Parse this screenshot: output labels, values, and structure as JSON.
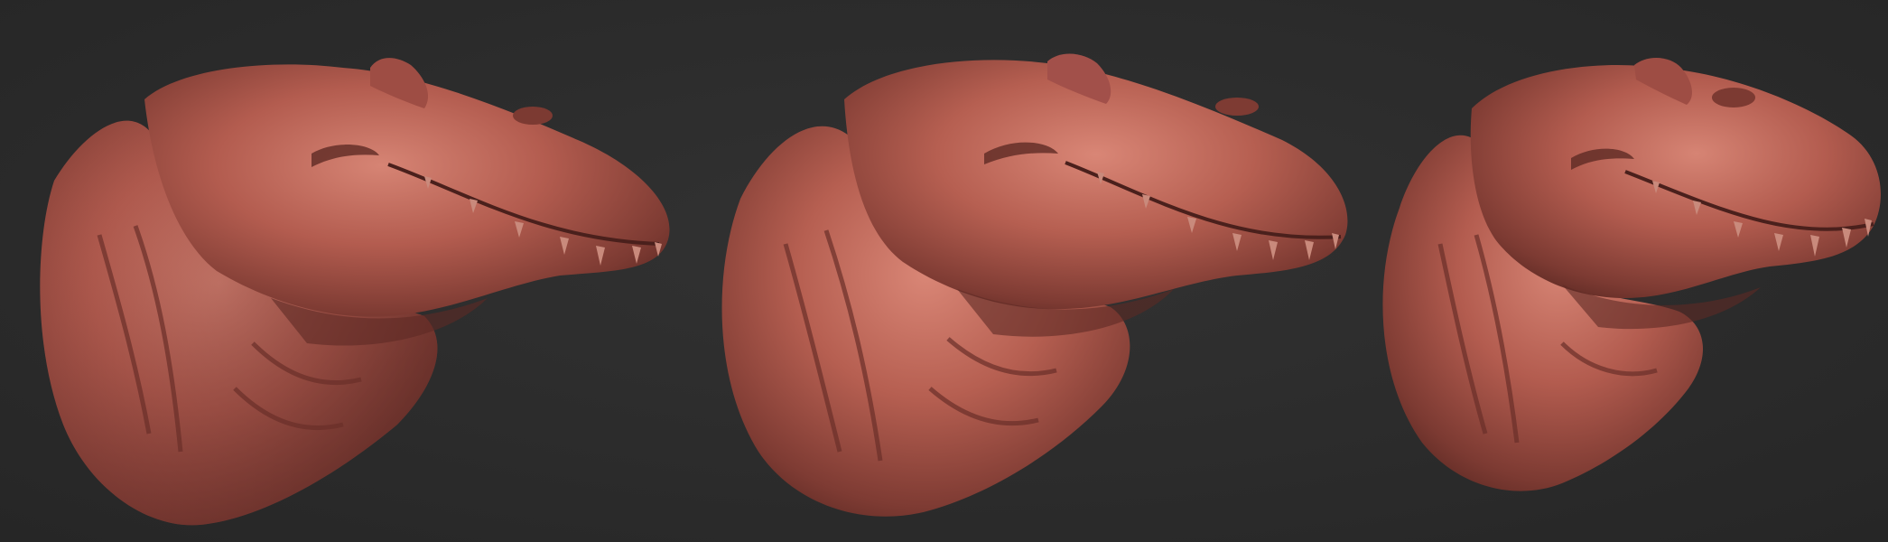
{
  "scene": {
    "background": "#2c2c2c",
    "material_base": "#b35c4f",
    "material_highlight": "#d68474",
    "material_shadow": "#5e2a24",
    "tooth_color": "#c98a7c"
  },
  "renders": [
    {
      "view": "left-three-quarter"
    },
    {
      "view": "three-quarter"
    },
    {
      "view": "front-three-quarter"
    }
  ]
}
